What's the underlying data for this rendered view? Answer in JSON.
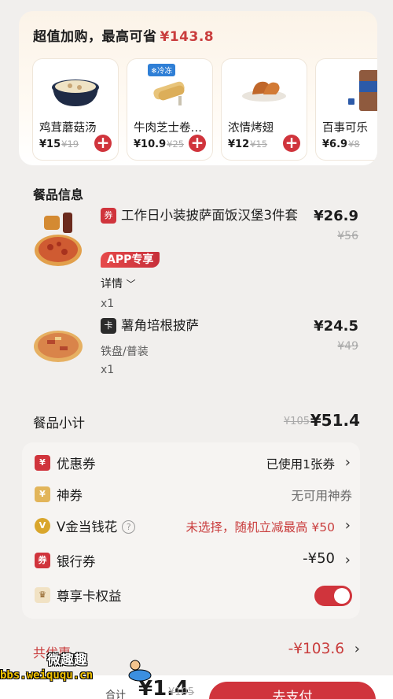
{
  "upsell": {
    "title": "超值加购，最高可省",
    "save_amount": "¥143.8",
    "products": [
      {
        "name": "鸡茸蘑菇汤",
        "price": "¥15",
        "old_price": "¥19",
        "icon": "soup-bowl",
        "tag": ""
      },
      {
        "name": "牛肉芝士卷…",
        "price": "¥10.9",
        "old_price": "¥25",
        "icon": "beef-cheese-roll",
        "tag": "冷冻"
      },
      {
        "name": "浓情烤翅",
        "price": "¥12",
        "old_price": "¥15",
        "icon": "roasted-wings",
        "tag": ""
      },
      {
        "name": "百事可乐",
        "price": "¥6.9",
        "old_price": "¥8",
        "icon": "pepsi-cola",
        "tag": ""
      }
    ]
  },
  "meal": {
    "section_title": "餐品信息",
    "items": [
      {
        "badge": "券",
        "badge_color": "#d0343c",
        "title": "工作日小装披萨面饭汉堡3件套",
        "price": "¥26.9",
        "old_price": "¥56",
        "tag": "APP专享",
        "details": "详情",
        "qty": "x1",
        "icon": "pizza-combo"
      },
      {
        "badge": "卡",
        "badge_color": "#2b2b2b",
        "title": "薯角培根披萨",
        "price": "¥24.5",
        "old_price": "¥49",
        "spec": "铁盘/普装",
        "qty": "x1",
        "icon": "bacon-pizza"
      }
    ]
  },
  "subtotal": {
    "label": "餐品小计",
    "old": "¥105",
    "now": "¥51.4"
  },
  "discounts": [
    {
      "icon": "coupon-icon",
      "label": "优惠券",
      "value": "已使用1张券",
      "value_color": "#1c1c1c",
      "chevron": true
    },
    {
      "icon": "god-coupon-icon",
      "label": "神券",
      "value": "无可用神券",
      "value_color": "#666666",
      "chevron": false
    },
    {
      "icon": "v-gold-icon",
      "label": "V金当钱花",
      "value": "未选择，随机立减最高 ¥50",
      "value_color": "#c93d3d",
      "chevron": true
    },
    {
      "icon": "bank-coupon-icon",
      "label": "银行券",
      "value": "-¥50",
      "value_color": "#1c1c1c",
      "chevron": true
    },
    {
      "icon": "crown-icon",
      "label": "尊享卡权益",
      "toggle": true
    }
  ],
  "total_discount": {
    "label": "共优惠",
    "value": "-¥103.6"
  },
  "bottom": {
    "total_label": "合计",
    "total": "¥1.4",
    "total_old": "¥105",
    "pay_label": "去支付"
  },
  "watermark": {
    "top": "微趣趣",
    "url": "bbs.weiququ.cn"
  },
  "colors": {
    "accent": "#d0343c",
    "discount_text": "#c93d3d",
    "panel_bg": "#f6f4f2"
  }
}
